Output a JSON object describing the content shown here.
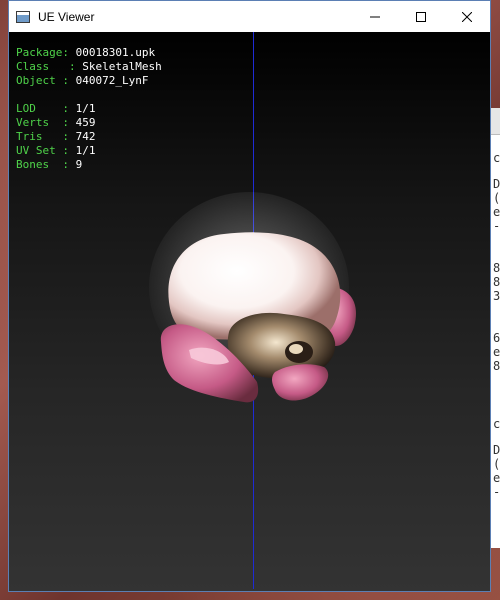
{
  "window": {
    "title": "UE Viewer",
    "icon": "app-window-icon",
    "controls": {
      "minimize_icon": "minimize-icon",
      "maximize_icon": "maximize-icon",
      "close_icon": "close-icon"
    }
  },
  "info": {
    "package_label": "Package",
    "package_value": "00018301.upk",
    "class_label": "Class",
    "class_value": "SkeletalMesh",
    "object_label": "Object",
    "object_value": "040072_LynF",
    "lod_label": "LOD",
    "lod_value": "1/1",
    "verts_label": "Verts",
    "verts_value": "459",
    "tris_label": "Tris",
    "tris_value": "742",
    "uvset_label": "UV Set",
    "uvset_value": "1/1",
    "bones_label": "Bones",
    "bones_value": "9"
  },
  "colors": {
    "label_green": "#4fd34a",
    "value_white": "#ffffff",
    "axis_blue": "#1e2bd6"
  },
  "background_window": {
    "glyphs": [
      "c",
      "D",
      "(",
      "e",
      "-",
      "8",
      "8",
      "3",
      "6",
      "e",
      "8",
      "c",
      "D",
      "(",
      "e",
      "-"
    ]
  }
}
